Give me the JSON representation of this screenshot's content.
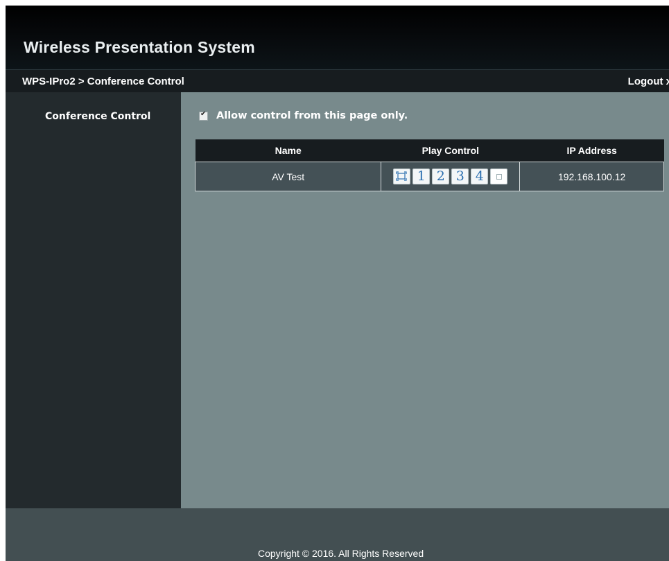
{
  "header": {
    "title": "Wireless Presentation System"
  },
  "breadcrumb": {
    "text": "WPS-IPro2 > Conference Control",
    "logout": "Logout x"
  },
  "sidebar": {
    "items": [
      {
        "label": "Conference Control"
      }
    ]
  },
  "main": {
    "allow_control": {
      "checked": true,
      "label": "Allow control from this page only."
    },
    "table": {
      "headers": [
        "Name",
        "Play Control",
        "IP Address"
      ],
      "rows": [
        {
          "name": "AV Test",
          "play_buttons": [
            "fullscreen-icon",
            "1",
            "2",
            "3",
            "4",
            "stop-icon"
          ],
          "ip": "192.168.100.12"
        }
      ]
    }
  },
  "footer": {
    "copyright": "Copyright © 2016. All Rights Reserved"
  },
  "colors": {
    "header_bg": "#000000",
    "sidebar_bg": "#232a2d",
    "main_bg": "#788a8c",
    "table_header_bg": "#171c1f",
    "table_row_bg": "#445156",
    "footer_bg": "#434f52",
    "play_number": "#2a6fb0"
  }
}
